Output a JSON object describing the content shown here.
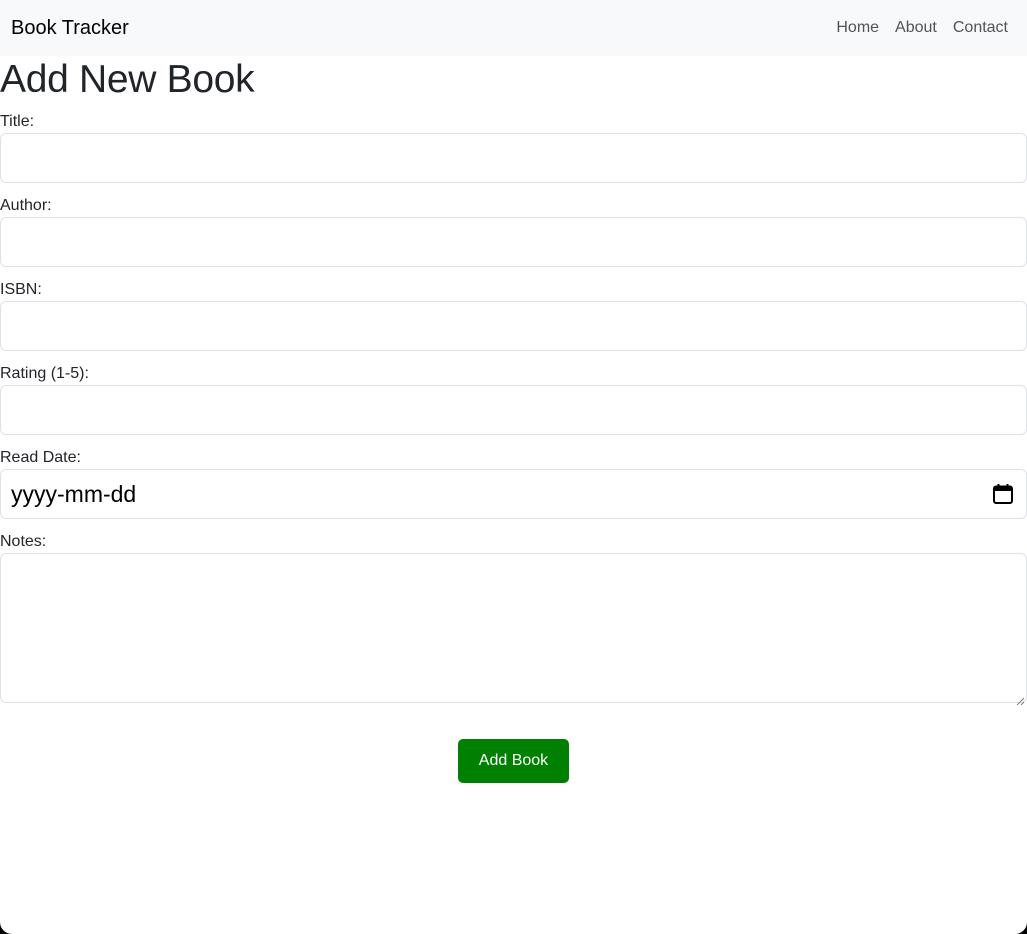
{
  "navbar": {
    "brand": "Book Tracker",
    "links": [
      "Home",
      "About",
      "Contact"
    ]
  },
  "page": {
    "title": "Add New Book"
  },
  "form": {
    "title_label": "Title:",
    "title_value": "",
    "author_label": "Author:",
    "author_value": "",
    "isbn_label": "ISBN:",
    "isbn_value": "",
    "rating_label": "Rating (1-5):",
    "rating_value": "",
    "read_date_label": "Read Date:",
    "read_date_placeholder": "yyyy-mm-dd",
    "notes_label": "Notes:",
    "notes_value": "",
    "submit_label": "Add Book"
  },
  "icons": {
    "date_picker": "calendar-icon",
    "textarea_resize": "resize-handle-icon"
  },
  "colors": {
    "navbar_bg": "#f8f9fa",
    "submit_bg": "#008000",
    "submit_text": "#ffffff",
    "input_border": "#dee2e6"
  }
}
